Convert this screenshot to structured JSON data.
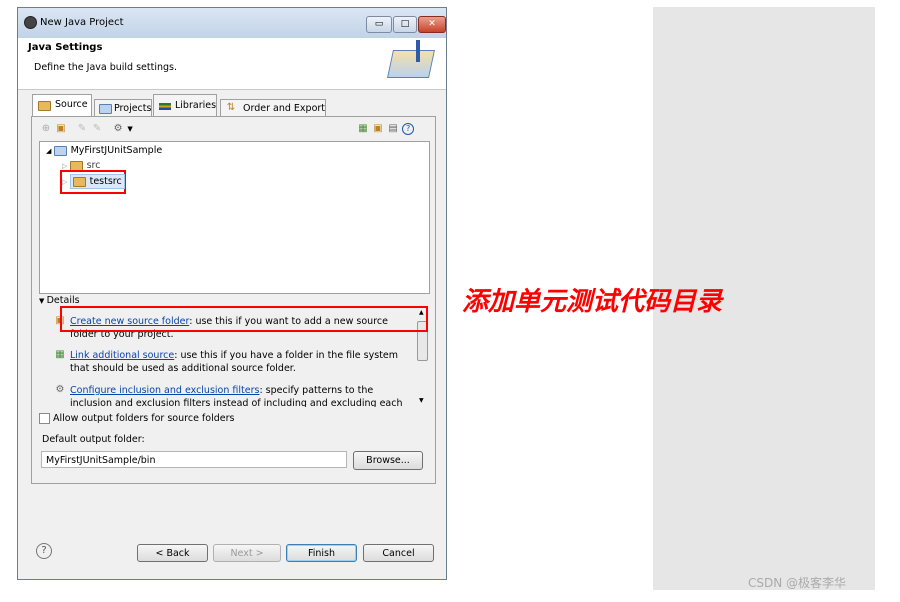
{
  "window": {
    "title": "New Java Project",
    "min": "▭",
    "max": "□",
    "close": "✕"
  },
  "header": {
    "title": "Java Settings",
    "description": "Define the Java build settings."
  },
  "tabs": [
    {
      "label": "Source"
    },
    {
      "label": "Projects"
    },
    {
      "label": "Libraries"
    },
    {
      "label": "Order and Export"
    }
  ],
  "tree": {
    "project": "MyFirstJUnitSample",
    "children": [
      {
        "label": "src"
      },
      {
        "label": "testsrc"
      }
    ]
  },
  "details": {
    "label": "Details",
    "items": [
      {
        "link": "Create new source folder",
        "text": ": use this if you want to add a new source folder to your project."
      },
      {
        "link": "Link additional source",
        "text": ": use this if you have a folder in the file system that should be used as additional source folder."
      },
      {
        "link": "Configure inclusion and exclusion filters",
        "text": ": specify patterns to the inclusion and exclusion filters instead of including and excluding each folder or file"
      }
    ]
  },
  "allow_output_label": "Allow output folders for source folders",
  "output": {
    "label": "Default output folder:",
    "value": "MyFirstJUnitSample/bin",
    "browse": "Browse..."
  },
  "buttons": {
    "help": "?",
    "back": "< Back",
    "next": "Next >",
    "finish": "Finish",
    "cancel": "Cancel"
  },
  "annotation": {
    "text": "添加单元测试代码目录",
    "color": "#ff0000"
  },
  "watermark": "CSDN @极客李华"
}
